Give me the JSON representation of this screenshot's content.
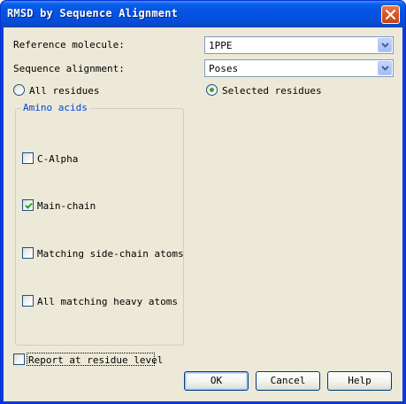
{
  "window": {
    "title": "RMSD by Sequence Alignment"
  },
  "reference_molecule": {
    "label": "Reference molecule:",
    "value": "1PPE"
  },
  "sequence_alignment": {
    "label": "Sequence alignment:",
    "value": "Poses"
  },
  "residues": {
    "all_label": "All residues",
    "selected_label": "Selected residues",
    "selected": "Selected residues"
  },
  "amino_acids": {
    "title": "Amino acids",
    "options": [
      {
        "label": "C-Alpha",
        "checked": false
      },
      {
        "label": "Main-chain",
        "checked": true
      },
      {
        "label": "Matching side-chain atoms",
        "checked": false
      },
      {
        "label": "All matching heavy atoms",
        "checked": false
      }
    ]
  },
  "report": {
    "label": "Report at residue level",
    "checked": false
  },
  "buttons": {
    "ok": "OK",
    "cancel": "Cancel",
    "help": "Help"
  },
  "colors": {
    "titlebar": "#0553e3",
    "client": "#ece9d8",
    "group_title": "#0046d5",
    "check_mark": "#21a121"
  }
}
